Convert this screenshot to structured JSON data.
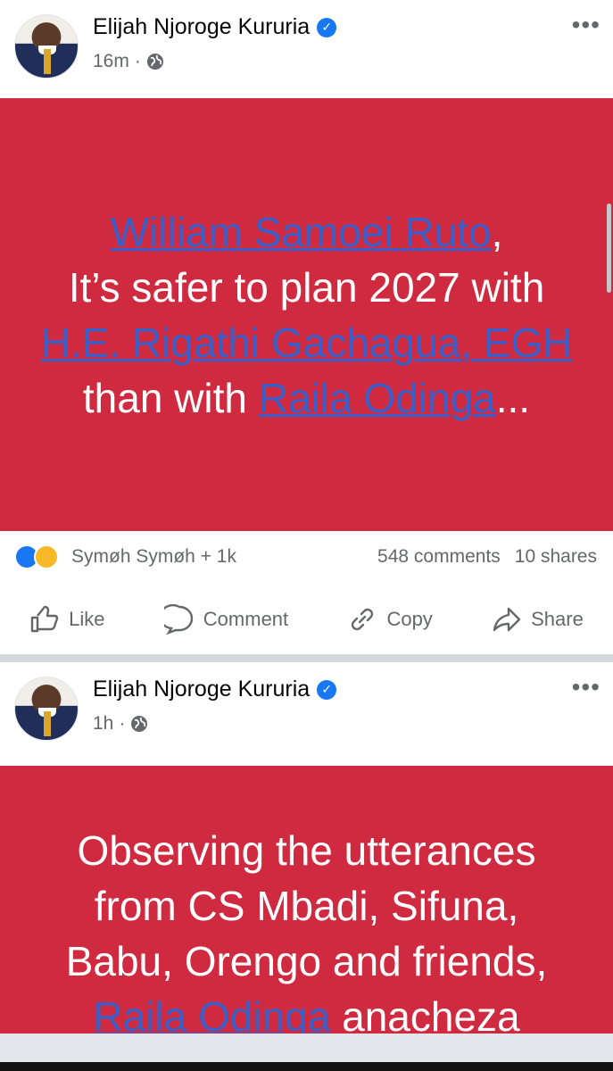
{
  "posts": [
    {
      "author": "Elijah Njoroge Kururia",
      "time": "16m",
      "separator": "·",
      "banner": {
        "part1": "William Samoei Ruto",
        "part2": ",",
        "part3": "It’s safer to plan 2027 with",
        "part4": "H.E. Rigathi Gachagua, EGH",
        "part5": "than with",
        "part6": "Raila Odinga",
        "part7": "..."
      },
      "reactors": "Symøh Symøh + 1k",
      "comments": "548 comments",
      "shares": "10 shares"
    },
    {
      "author": "Elijah Njoroge Kururia",
      "time": "1h",
      "separator": "·",
      "banner": {
        "part1": "Observing the utterances from CS Mbadi, Sifuna, Babu, Orengo and friends,",
        "part2": "Raila Odinga",
        "part3": "anacheza"
      }
    }
  ],
  "actions": {
    "like": "Like",
    "comment": "Comment",
    "copy": "Copy",
    "share": "Share"
  },
  "icons": [
    "verified-badge-icon",
    "globe-icon",
    "more-options-icon",
    "like-reaction-icon",
    "haha-reaction-icon",
    "thumbs-up-icon",
    "comment-bubble-icon",
    "link-icon",
    "share-arrow-icon"
  ],
  "colors": {
    "banner": "#cf2a3f",
    "mention": "#3a5fc8",
    "verified": "#1877f2"
  }
}
